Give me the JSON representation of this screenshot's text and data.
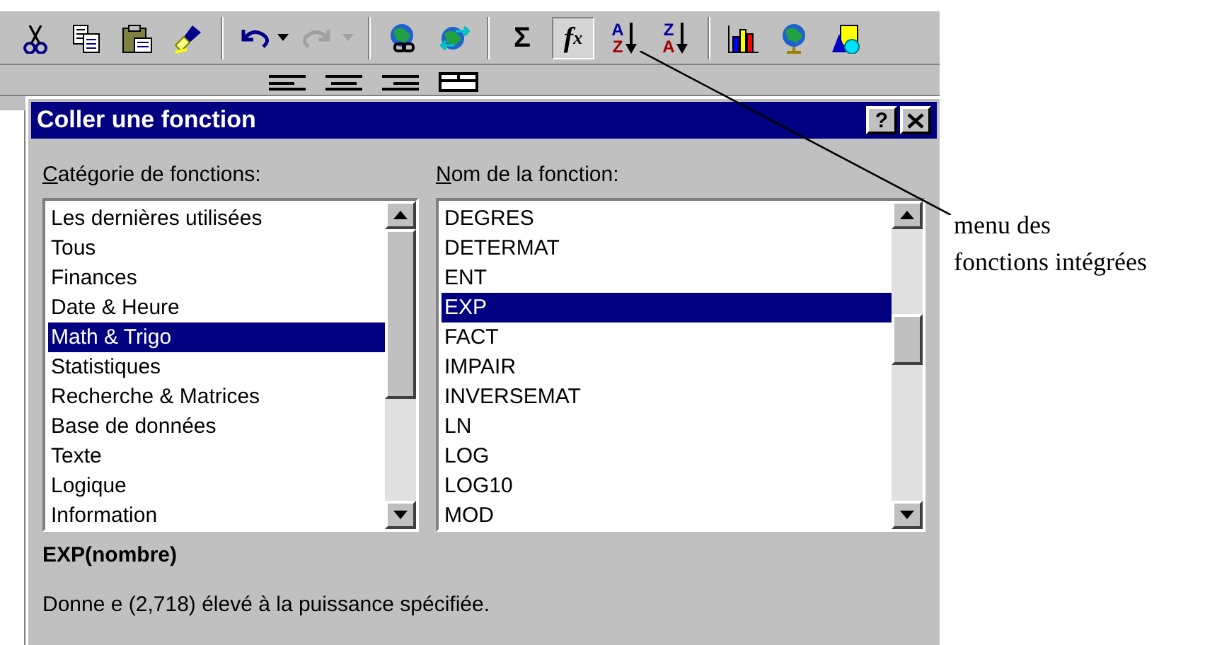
{
  "toolbar": [
    {
      "kind": "cut"
    },
    {
      "kind": "copy"
    },
    {
      "kind": "paste"
    },
    {
      "kind": "brush"
    },
    {
      "kind": "sep"
    },
    {
      "kind": "undo",
      "disabled": false
    },
    {
      "kind": "redo",
      "disabled": true
    },
    {
      "kind": "sep"
    },
    {
      "kind": "globe-link"
    },
    {
      "kind": "globe-arrows"
    },
    {
      "kind": "sep"
    },
    {
      "kind": "text",
      "label": "Σ",
      "pressed": false
    },
    {
      "kind": "fx",
      "label": "f",
      "sub": "x",
      "pressed": true
    },
    {
      "kind": "sort",
      "top": "A",
      "bottom": "Z"
    },
    {
      "kind": "sort",
      "top": "Z",
      "bottom": "A"
    },
    {
      "kind": "sep"
    },
    {
      "kind": "chart"
    },
    {
      "kind": "globe-stand"
    },
    {
      "kind": "shapes"
    }
  ],
  "dialog": {
    "title": "Coller une fonction",
    "help": "?",
    "category_label": "Catégorie de fonctions:",
    "categories": [
      {
        "label": "Les dernières utilisées",
        "selected": false
      },
      {
        "label": "Tous",
        "selected": false
      },
      {
        "label": "Finances",
        "selected": false
      },
      {
        "label": "Date & Heure",
        "selected": false
      },
      {
        "label": "Math & Trigo",
        "selected": true
      },
      {
        "label": "Statistiques",
        "selected": false
      },
      {
        "label": "Recherche & Matrices",
        "selected": false
      },
      {
        "label": "Base de données",
        "selected": false
      },
      {
        "label": "Texte",
        "selected": false
      },
      {
        "label": "Logique",
        "selected": false
      },
      {
        "label": "Information",
        "selected": false
      }
    ],
    "function_label": "Nom de la fonction:",
    "functions": [
      {
        "label": "DEGRES",
        "selected": false
      },
      {
        "label": "DETERMAT",
        "selected": false
      },
      {
        "label": "ENT",
        "selected": false
      },
      {
        "label": "EXP",
        "selected": true
      },
      {
        "label": "FACT",
        "selected": false
      },
      {
        "label": "IMPAIR",
        "selected": false
      },
      {
        "label": "INVERSEMAT",
        "selected": false
      },
      {
        "label": "LN",
        "selected": false
      },
      {
        "label": "LOG",
        "selected": false
      },
      {
        "label": "LOG10",
        "selected": false
      },
      {
        "label": "MOD",
        "selected": false
      }
    ],
    "syntax": "EXP(nombre)",
    "description": "Donne e (2,718) élevé à la puissance spécifiée."
  },
  "annotation": {
    "lines": [
      "menu des",
      "fonctions intégrées"
    ]
  }
}
